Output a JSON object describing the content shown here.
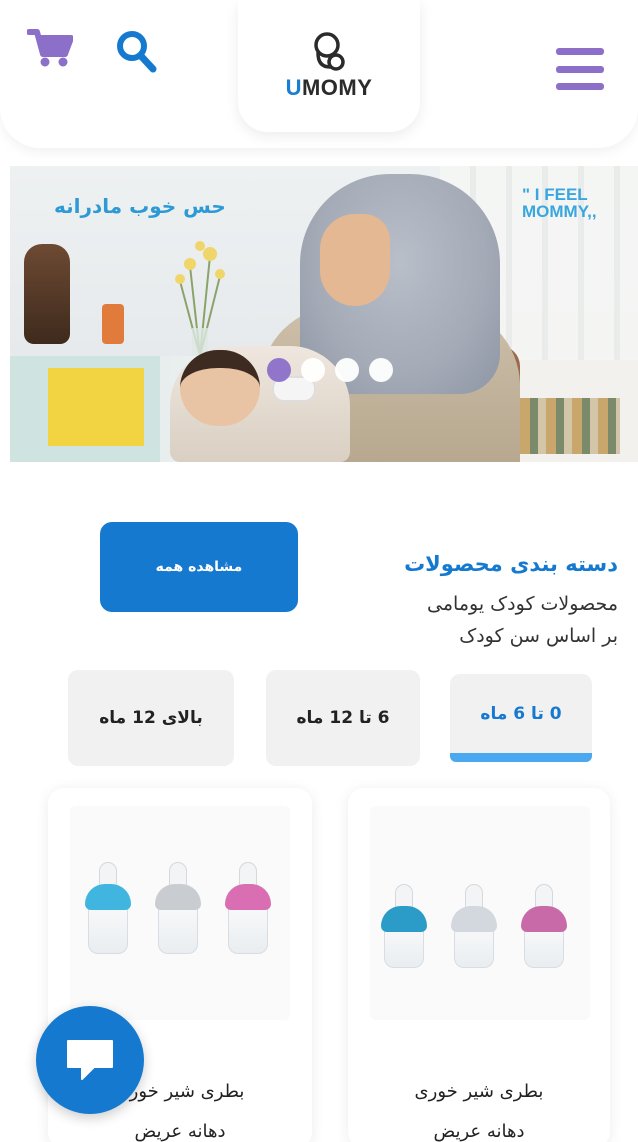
{
  "header": {
    "logo_text_u": "U",
    "logo_text_rest": "MOMY",
    "icons": [
      "cart-icon",
      "search-icon",
      "menu-icon",
      "logo-icon"
    ],
    "accent_color": "#8b6fc9",
    "brand_color": "#1679d0"
  },
  "hero": {
    "tagline_fa": "حس خوب مادرانه",
    "tagline_en_line1": "\" I FEEL",
    "tagline_en_line2": "MOMMY,,",
    "slide_count": 4,
    "active_slide": 1
  },
  "categories": {
    "title": "دسته بندی محصولات",
    "subtitle_line1": "محصولات کودک یومامی",
    "subtitle_line2": "بر اساس سن کودک",
    "view_all_label": "مشاهده همه",
    "tabs": [
      {
        "label": "0 تا 6 ماه",
        "active": true
      },
      {
        "label": "6 تا 12 ماه",
        "active": false
      },
      {
        "label": "بالای 12 ماه",
        "active": false
      }
    ]
  },
  "products": [
    {
      "name_line1": "بطری شیر خوری",
      "name_line2": "دهانه عریض"
    },
    {
      "name_line1": "بطری شیر خوری",
      "name_line2": "دهانه عریض"
    }
  ],
  "chat": {
    "icon": "chat-icon"
  }
}
